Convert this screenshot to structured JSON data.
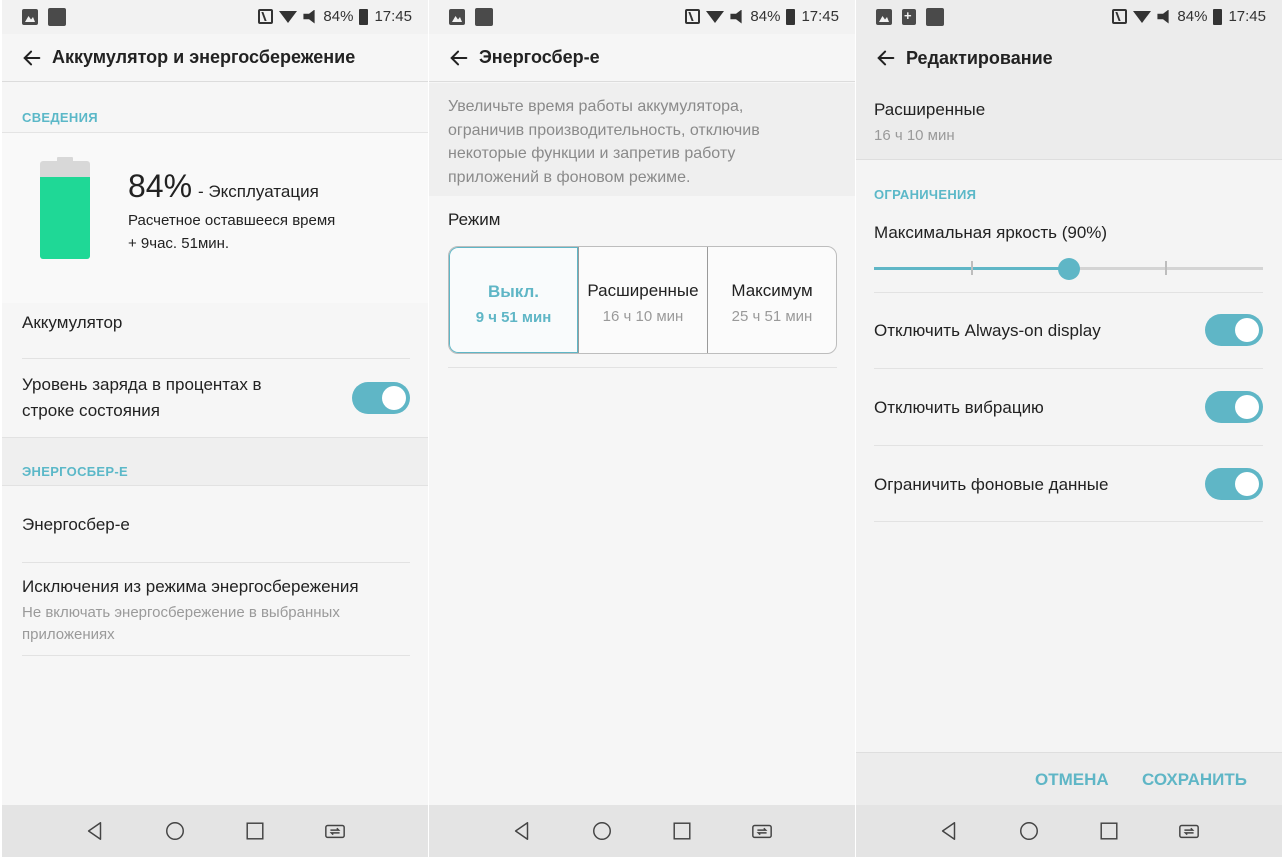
{
  "status_bar": {
    "battery": "84%",
    "time": "17:45"
  },
  "nav_bar": {
    "items": [
      "back",
      "home",
      "recents",
      "switch-sim"
    ]
  },
  "accent_color": "#5fb6c6",
  "screen1": {
    "title": "Аккумулятор и энергосбережение",
    "section_info": "СВЕДЕНИЯ",
    "battery_percent": "84%",
    "battery_status": "- Эксплуатация",
    "remaining_label": "Расчетное оставшееся время",
    "remaining_value": "+ 9час. 51мин.",
    "battery_level": 0.84,
    "item_battery": "Аккумулятор",
    "item_percent_line1": "Уровень заряда в процентах в",
    "item_percent_line2": "строке состояния",
    "section_saver": "ЭНЕРГОСБЕР-Е",
    "item_saver": "Энергосбер-е",
    "item_exceptions": "Исключения из режима энергосбережения",
    "item_exceptions_sub1": "Не включать энергосбережение в выбранных",
    "item_exceptions_sub2": "приложениях"
  },
  "screen2": {
    "title": "Энергосбер-е",
    "desc_line1": "Увеличьте время работы аккумулятора,",
    "desc_line2": "ограничив производительность, отключив",
    "desc_line3": "некоторые функции и запретив работу",
    "desc_line4": "приложений в фоновом режиме.",
    "mode_label": "Режим",
    "modes": [
      {
        "name": "Выкл.",
        "time": "9 ч 51 мин"
      },
      {
        "name": "Расширенные",
        "time": "16 ч 10 мин"
      },
      {
        "name": "Максимум",
        "time": "25 ч 51 мин"
      }
    ]
  },
  "screen3": {
    "title": "Редактирование",
    "mode_name": "Расширенные",
    "mode_time": "16 ч 10 мин",
    "section_limits": "ОГРАНИЧЕНИЯ",
    "brightness_label": "Максимальная яркость (90%)",
    "brightness_level": 0.5,
    "toggle_aod": "Отключить Always-on display",
    "toggle_vibration": "Отключить вибрацию",
    "toggle_bgdata": "Ограничить фоновые данные",
    "cancel": "ОТМЕНА",
    "save": "СОХРАНИТЬ"
  }
}
